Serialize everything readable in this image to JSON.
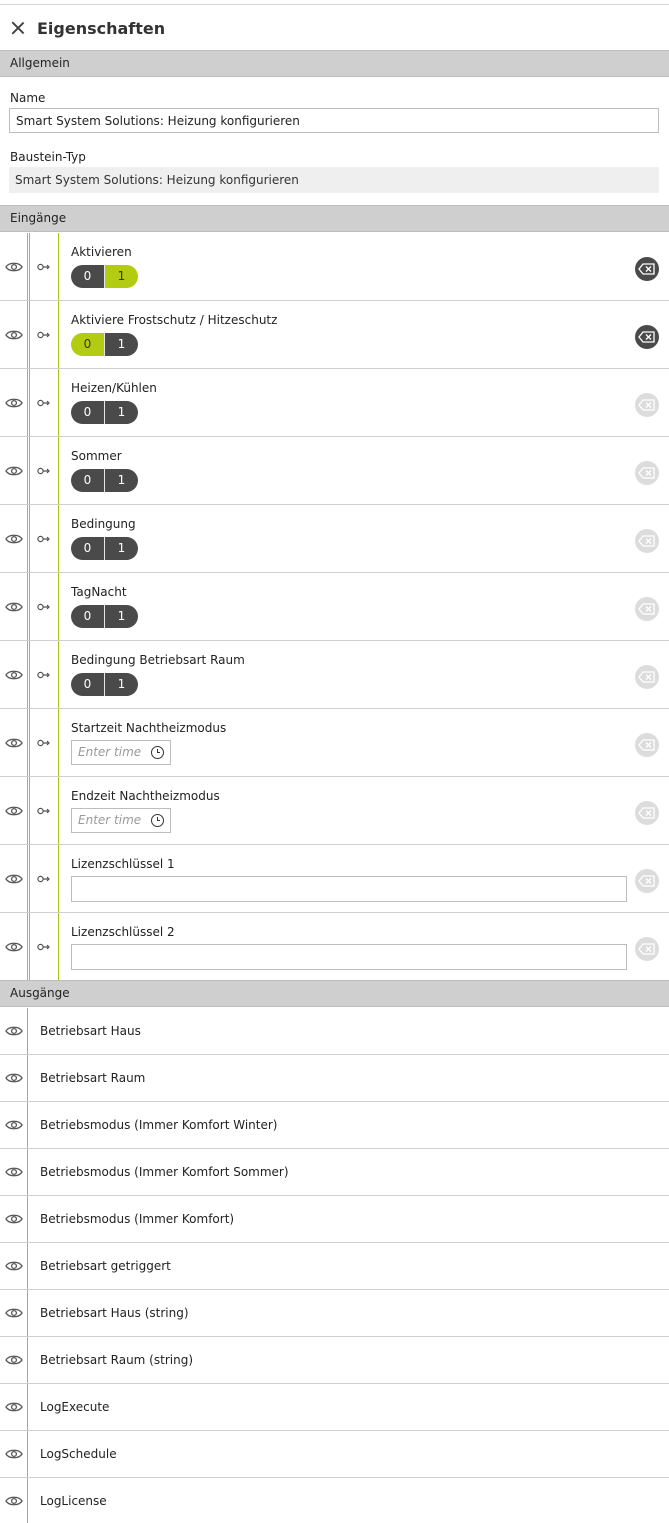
{
  "header": {
    "title": "Eigenschaften"
  },
  "general": {
    "section_label": "Allgemein",
    "name_label": "Name",
    "name_value": "Smart System Solutions: Heizung konfigurieren",
    "type_label": "Baustein-Typ",
    "type_value": "Smart System Solutions: Heizung konfigurieren"
  },
  "inputs": {
    "section_label": "Eingänge",
    "rows": [
      {
        "label": "Aktivieren",
        "kind": "toggle",
        "opt0": "0",
        "opt1": "1",
        "selected": "1",
        "clear_active": true
      },
      {
        "label": "Aktiviere Frostschutz / Hitzeschutz",
        "kind": "toggle",
        "opt0": "0",
        "opt1": "1",
        "selected": "0",
        "clear_active": true
      },
      {
        "label": "Heizen/Kühlen",
        "kind": "toggle",
        "opt0": "0",
        "opt1": "1",
        "selected": "",
        "clear_active": false
      },
      {
        "label": "Sommer",
        "kind": "toggle",
        "opt0": "0",
        "opt1": "1",
        "selected": "",
        "clear_active": false
      },
      {
        "label": "Bedingung",
        "kind": "toggle",
        "opt0": "0",
        "opt1": "1",
        "selected": "",
        "clear_active": false
      },
      {
        "label": "TagNacht",
        "kind": "toggle",
        "opt0": "0",
        "opt1": "1",
        "selected": "",
        "clear_active": false
      },
      {
        "label": "Bedingung Betriebsart Raum",
        "kind": "toggle",
        "opt0": "0",
        "opt1": "1",
        "selected": "",
        "clear_active": false
      },
      {
        "label": "Startzeit Nachtheizmodus",
        "kind": "time",
        "placeholder": "Enter time",
        "clear_active": false
      },
      {
        "label": "Endzeit Nachtheizmodus",
        "kind": "time",
        "placeholder": "Enter time",
        "clear_active": false
      },
      {
        "label": "Lizenzschlüssel 1",
        "kind": "text",
        "value": "",
        "clear_active": false
      },
      {
        "label": "Lizenzschlüssel 2",
        "kind": "text",
        "value": "",
        "clear_active": false
      }
    ]
  },
  "outputs": {
    "section_label": "Ausgänge",
    "rows": [
      {
        "label": "Betriebsart Haus"
      },
      {
        "label": "Betriebsart Raum"
      },
      {
        "label": "Betriebsmodus (Immer Komfort Winter)"
      },
      {
        "label": "Betriebsmodus (Immer Komfort Sommer)"
      },
      {
        "label": "Betriebsmodus (Immer Komfort)"
      },
      {
        "label": "Betriebsart getriggert"
      },
      {
        "label": "Betriebsart Haus (string)"
      },
      {
        "label": "Betriebsart Raum (string)"
      },
      {
        "label": "LogExecute"
      },
      {
        "label": "LogSchedule"
      },
      {
        "label": "LogLicense"
      }
    ]
  },
  "colors": {
    "accent": "#b3cc12",
    "border_accent": "#a8c21a",
    "toggle_dark": "#4a4a4a",
    "section_bg": "#cfcfcf"
  }
}
